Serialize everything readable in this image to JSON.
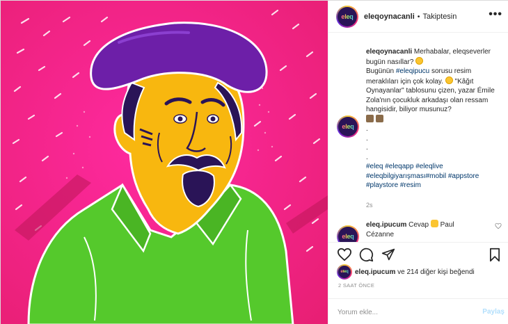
{
  "post": {
    "username": "eleqoynacanli",
    "separator": "•",
    "follow_state": "Takiptesin",
    "more_label": "•••",
    "avatar_text": "eleq"
  },
  "caption": {
    "username": "eleqoynacanli",
    "text_1": "Merhabalar, eleqseverler bugün nasıllar?",
    "text_2": "Bugünün",
    "tag_1": "#eleqipucu",
    "text_3": "sorusu resim meraklıları için çok kolay.",
    "text_4": "\"Kâğıt Oynayanlar\" tablosunu çizen, yazar Émile Zola'nın çocukluk arkadaşı olan ressam hangisidir, biliyor musunuz?",
    "dots": [
      ".",
      ".",
      ".",
      "."
    ],
    "hashtags": [
      "#eleq",
      "#eleqapp",
      "#eleqlive",
      "#eleqbilgiyarışması",
      "#mobil",
      "#appstore",
      "#playstore",
      "#resim"
    ],
    "time": "2s"
  },
  "comment": {
    "username": "eleq.ipucum",
    "text_1": "Cevap",
    "text_2": "Paul Cézanne"
  },
  "likes": {
    "username": "eleq.ipucum",
    "text": "ve 214 diğer kişi beğendi"
  },
  "timestamp": "2 SAAT ÖNCE",
  "composer": {
    "placeholder": "Yorum ekle...",
    "post_label": "Paylaş"
  },
  "icons": [
    "heart-icon",
    "comment-icon",
    "share-icon",
    "bookmark-icon",
    "more-icon",
    "smile-emoji",
    "pointing-hand-emoji"
  ],
  "colors": {
    "art_background": "#f0287e",
    "hat": "#6d1fa8",
    "face": "#f8b70f",
    "shirt": "#55c92c",
    "hair": "#2a1457",
    "link": "#00376b",
    "post_button": "#b2dffc"
  }
}
